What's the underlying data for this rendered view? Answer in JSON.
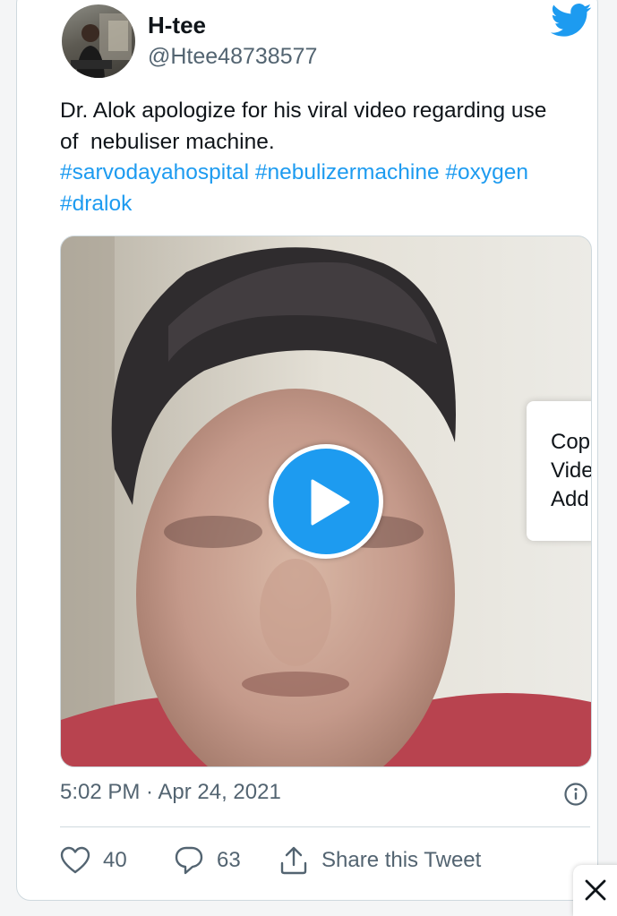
{
  "tweet": {
    "author_name": "H-tee",
    "author_handle": "@Htee48738577",
    "text_line1": "Dr. Alok apologize for his viral video regarding use",
    "text_line2": "of  nebuliser machine.",
    "hashtags_line1": "#sarvodayahospital #nebulizermachine #oxygen",
    "hashtags_line2": "#dralok",
    "timestamp": "5:02 PM · Apr 24, 2021"
  },
  "context_menu": {
    "items": [
      "Cop",
      "Vide",
      "Add"
    ]
  },
  "actions": {
    "likes": "40",
    "replies": "63",
    "share_label": "Share this Tweet"
  },
  "icons": [
    "twitter-logo-icon",
    "play-icon",
    "info-icon",
    "heart-icon",
    "reply-bubble-icon",
    "share-icon",
    "close-icon"
  ],
  "colors": {
    "brand": "#1d9bf0",
    "text": "#0f1419",
    "secondary": "#536471",
    "border": "#cfd9de"
  }
}
